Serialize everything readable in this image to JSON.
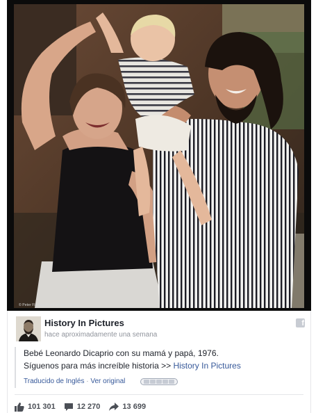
{
  "photo": {
    "credit": "© Peter Fleming/Rex/Lockner, Corbis"
  },
  "post": {
    "page_name": "History In Pictures",
    "timestamp": "hace aproximadamente una semana",
    "line1": "Bebé Leonardo Dicaprio con su mamá y papá, 1976.",
    "line2_prefix": "Síguenos para más increíble historia >> ",
    "line2_link": "History In Pictures",
    "translated_label": "Traducido de Inglés",
    "separator": " · ",
    "see_original": "Ver original"
  },
  "stats": {
    "likes": "101 301",
    "comments": "12 270",
    "shares": "13 699"
  },
  "icons": {
    "facebook": "facebook-icon",
    "like": "thumbs-up-icon",
    "comment": "speech-bubble-icon",
    "share": "share-arrow-icon"
  },
  "colors": {
    "link": "#365899",
    "muted": "#90949c",
    "text": "#1d2129"
  }
}
